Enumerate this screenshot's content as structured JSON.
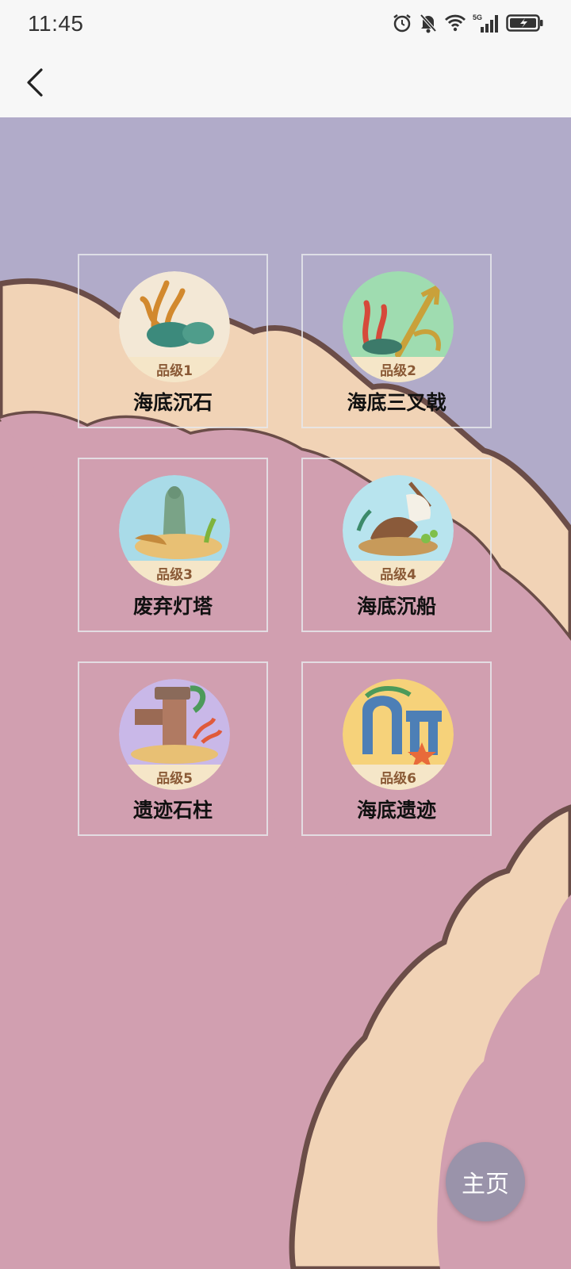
{
  "status_bar": {
    "time": "11:45",
    "network": "5G"
  },
  "items": [
    {
      "name": "海底沉石",
      "grade": "品级1",
      "icon": "sea-rock-icon"
    },
    {
      "name": "海底三叉戟",
      "grade": "品级2",
      "icon": "trident-icon"
    },
    {
      "name": "废弃灯塔",
      "grade": "品级3",
      "icon": "lighthouse-icon"
    },
    {
      "name": "海底沉船",
      "grade": "品级4",
      "icon": "shipwreck-icon"
    },
    {
      "name": "遗迹石柱",
      "grade": "品级5",
      "icon": "stone-pillar-icon"
    },
    {
      "name": "海底遗迹",
      "grade": "品级6",
      "icon": "ruins-icon"
    }
  ],
  "fab": {
    "label": "主页"
  },
  "colors": {
    "background_purple": "#b1abc9",
    "background_pink": "#d19fb0",
    "cloud": "#f1d3b6",
    "fab": "#9a93aa"
  }
}
